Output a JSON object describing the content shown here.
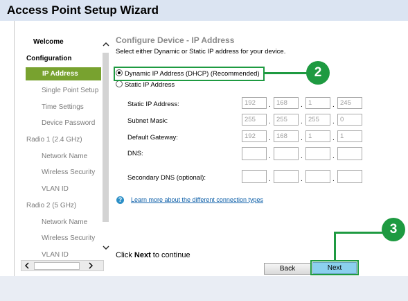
{
  "window": {
    "title": "Access Point Setup Wizard"
  },
  "sidebar": {
    "items": [
      {
        "label": "Welcome",
        "kind": "section"
      },
      {
        "label": "Configuration",
        "kind": "section"
      },
      {
        "label": "IP Address",
        "kind": "active"
      },
      {
        "label": "Single Point Setup",
        "kind": "sub"
      },
      {
        "label": "Time Settings",
        "kind": "sub"
      },
      {
        "label": "Device Password",
        "kind": "sub"
      },
      {
        "label": "Radio 1 (2.4 GHz)",
        "kind": "section-gray"
      },
      {
        "label": "Network Name",
        "kind": "sub"
      },
      {
        "label": "Wireless Security",
        "kind": "sub"
      },
      {
        "label": "VLAN ID",
        "kind": "sub"
      },
      {
        "label": "Radio 2 (5 GHz)",
        "kind": "section-gray"
      },
      {
        "label": "Network Name",
        "kind": "sub"
      },
      {
        "label": "Wireless Security",
        "kind": "sub"
      },
      {
        "label": "VLAN ID",
        "kind": "sub"
      }
    ],
    "scroll_up": "^",
    "scroll_down": "v",
    "scroll_left": "<",
    "scroll_right": ">"
  },
  "main": {
    "heading": "Configure Device - IP Address",
    "subtext": "Select either Dynamic or Static IP address for your device.",
    "options": {
      "dynamic": "Dynamic IP Address (DHCP) (Recommended)",
      "static": "Static IP Address",
      "selected": "dynamic"
    },
    "fields": {
      "static_ip": {
        "label": "Static IP Address:",
        "octets": [
          "192",
          "168",
          "1",
          "245"
        ]
      },
      "subnet": {
        "label": "Subnet Mask:",
        "octets": [
          "255",
          "255",
          "255",
          "0"
        ]
      },
      "gateway": {
        "label": "Default Gateway:",
        "octets": [
          "192",
          "168",
          "1",
          "1"
        ]
      },
      "dns": {
        "label": "DNS:",
        "octets": [
          "",
          "",
          "",
          ""
        ]
      },
      "dns2": {
        "label": "Secondary DNS (optional):",
        "octets": [
          "",
          "",
          "",
          ""
        ]
      }
    },
    "help_icon": "?",
    "help_link": "Learn more about the different connection types",
    "continue_prefix": "Click ",
    "continue_bold": "Next",
    "continue_suffix": " to continue"
  },
  "buttons": {
    "back": "Back",
    "next": "Next"
  },
  "callouts": {
    "step2": "2",
    "step3": "3"
  },
  "colors": {
    "accent": "#78a22f",
    "callout": "#1e9a41",
    "next_button": "#8bd0ee",
    "titlebar": "#dbe4f2"
  }
}
